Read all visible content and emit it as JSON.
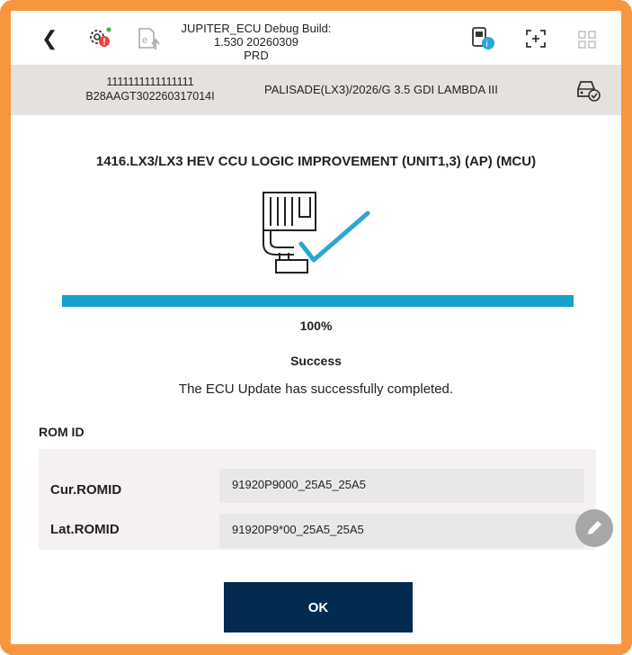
{
  "topbar": {
    "back_icon": "chevron-left-icon",
    "title_line1": "JUPITER_ECU Debug Build: 1.530 20260309",
    "title_line2": "PRD",
    "icons": [
      "settings-alert-icon",
      "export-icon",
      "device-info-icon",
      "screen-capture-icon",
      "grid-menu-icon"
    ]
  },
  "vehicle": {
    "id_line1": "1111111111111111",
    "id_line2": "B28AAGT302260317014I",
    "name": "PALISADE(LX3)/2026/G 3.5 GDI LAMBDA III",
    "status_icon": "car-check-icon"
  },
  "update": {
    "title": "1416.LX3/LX3 HEV CCU LOGIC IMPROVEMENT (UNIT1,3) (AP) (MCU)",
    "progress": 1.0,
    "percent_text": "100%",
    "status": "Success",
    "message": "The ECU Update has successfully completed."
  },
  "rom": {
    "title": "ROM ID",
    "rows": [
      {
        "label": "Cur.ROMID",
        "value": "91920P9000_25A5_25A5"
      },
      {
        "label": "Lat.ROMID",
        "value": "91920P9*00_25A5_25A5"
      }
    ]
  },
  "actions": {
    "ok_label": "OK"
  },
  "colors": {
    "border": "#f7963e",
    "progress": "#17a1cd",
    "button": "#032a4f",
    "bar": "#e5e1dd"
  }
}
